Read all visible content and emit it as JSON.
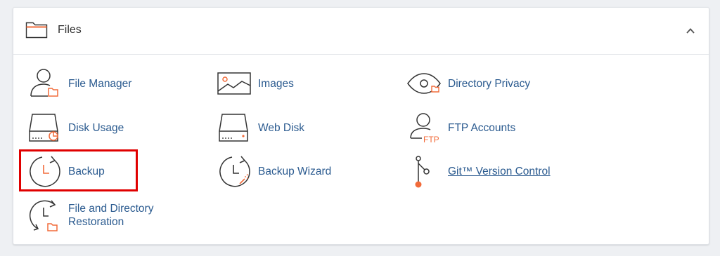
{
  "section": {
    "title": "Files",
    "icon": "folder-icon",
    "collapse_icon": "chevron-up-icon"
  },
  "items": [
    {
      "label": "File Manager",
      "icon": "file-manager-icon"
    },
    {
      "label": "Images",
      "icon": "images-icon"
    },
    {
      "label": "Directory Privacy",
      "icon": "directory-privacy-icon"
    },
    {
      "label": "Disk Usage",
      "icon": "disk-usage-icon"
    },
    {
      "label": "Web Disk",
      "icon": "web-disk-icon"
    },
    {
      "label": "FTP Accounts",
      "icon": "ftp-accounts-icon"
    },
    {
      "label": "Backup",
      "icon": "backup-icon"
    },
    {
      "label": "Backup Wizard",
      "icon": "backup-wizard-icon"
    },
    {
      "label": "Git™ Version Control",
      "icon": "git-icon"
    },
    {
      "label": "File and Directory Restoration",
      "icon": "file-restoration-icon"
    }
  ],
  "ftp_icon_text": "FTP",
  "colors": {
    "accent": "#f26b3a",
    "link": "#2a5a8f",
    "highlight": "#e00000"
  }
}
